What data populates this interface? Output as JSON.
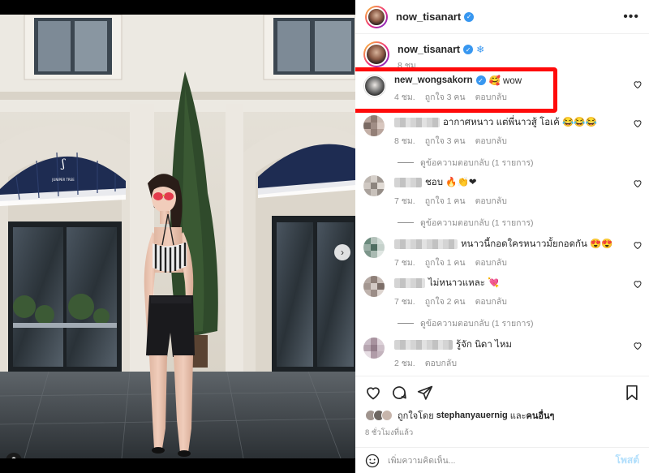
{
  "post": {
    "author": "now_tisanart",
    "caption_author": "now_tisanart",
    "caption_emoji": "❄",
    "caption_time": "8 ชม.",
    "awning_brand": "JUNIPER TREE"
  },
  "comments": [
    {
      "user": "new_wongsakorn",
      "verified": true,
      "text": "🥰 wow",
      "time": "4 ชม.",
      "likes": "ถูกใจ 3 คน",
      "reply": "ตอบกลับ",
      "highlighted": true
    },
    {
      "user": "",
      "text": "อากาศหนาว แต่พี่นาวสู้ โอเค้ 😂😂😂",
      "time": "8 ชม.",
      "likes": "ถูกใจ 3 คน",
      "reply": "ตอบกลับ",
      "view_replies": "ดูข้อความตอบกลับ (1 รายการ)"
    },
    {
      "user": "",
      "text": "ชอบ 🔥👏❤",
      "time": "7 ชม.",
      "likes": "ถูกใจ 1 คน",
      "reply": "ตอบกลับ",
      "view_replies": "ดูข้อความตอบกลับ (1 รายการ)"
    },
    {
      "user": "",
      "text": "หนาวนี้กอดใครหนาวมั้ยกอดกัน 😍😍",
      "time": "7 ชม.",
      "likes": "ถูกใจ 1 คน",
      "reply": "ตอบกลับ"
    },
    {
      "user": "",
      "text": "ไม่หนาวแหละ 💘",
      "time": "7 ชม.",
      "likes": "ถูกใจ 2 คน",
      "reply": "ตอบกลับ",
      "view_replies": "ดูข้อความตอบกลับ (1 รายการ)"
    },
    {
      "user": "",
      "text": "รู้จัก นิดา ไหม",
      "time": "2 ชม.",
      "reply": "ตอบกลับ"
    }
  ],
  "footer": {
    "liked_by_prefix": "ถูกใจโดย",
    "liked_by_user": "stephanyauernig",
    "liked_by_and": "และ",
    "liked_by_others": "คนอื่นๆ",
    "age": "8 ชั่วโมงที่แล้ว",
    "comment_placeholder": "เพิ่มความคิดเห็น...",
    "post_label": "โพสต์"
  },
  "icons": {
    "more": "more-options-icon",
    "verified": "verified-badge-icon",
    "heart": "heart-icon",
    "comment": "comment-icon",
    "share": "share-icon",
    "save": "bookmark-icon",
    "emoji": "emoji-icon",
    "next": "chevron-right-icon",
    "user_tag": "user-tag-icon"
  },
  "colors": {
    "highlight": "#ff0a0a",
    "verified": "#3897f0",
    "post_disabled": "#b2dffc",
    "awning": "#1e2c52"
  },
  "carousel": {
    "count": 4,
    "active": 0
  }
}
